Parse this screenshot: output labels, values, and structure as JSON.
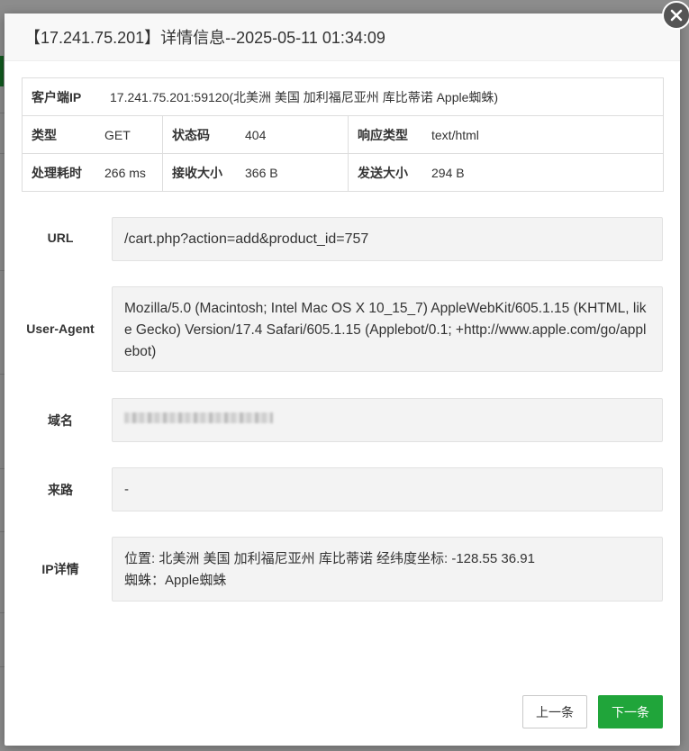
{
  "modal": {
    "title": "【17.241.75.201】详情信息--2025-05-11 01:34:09"
  },
  "summary": {
    "client_ip_label": "客户端IP",
    "client_ip_value": "17.241.75.201:59120(北美洲 美国 加利福尼亚州 库比蒂诺 Apple蜘蛛)",
    "type_label": "类型",
    "type_value": "GET",
    "status_label": "状态码",
    "status_value": "404",
    "content_type_label": "响应类型",
    "content_type_value": "text/html",
    "duration_label": "处理耗时",
    "duration_value": "266 ms",
    "received_label": "接收大小",
    "received_value": "366 B",
    "sent_label": "发送大小",
    "sent_value": "294 B"
  },
  "fields": {
    "url_label": "URL",
    "url_value": "/cart.php?action=add&product_id=757",
    "ua_label": "User-Agent",
    "ua_value": "Mozilla/5.0 (Macintosh; Intel Mac OS X 10_15_7) AppleWebKit/605.1.15 (KHTML, like Gecko) Version/17.4 Safari/605.1.15 (Applebot/0.1; +http://www.apple.com/go/applebot)",
    "domain_label": "域名",
    "referer_label": "来路",
    "referer_value": "-",
    "ipinfo_label": "IP详情",
    "ipinfo_location": "位置: 北美洲 美国 加利福尼亚州 库比蒂诺 经纬度坐标: -128.55 36.91",
    "ipinfo_spider": "蜘蛛：Apple蜘蛛"
  },
  "buttons": {
    "prev": "上一条",
    "next": "下一条"
  },
  "colors": {
    "accent": "#20a53a"
  },
  "icons": {
    "close": "close-icon"
  }
}
